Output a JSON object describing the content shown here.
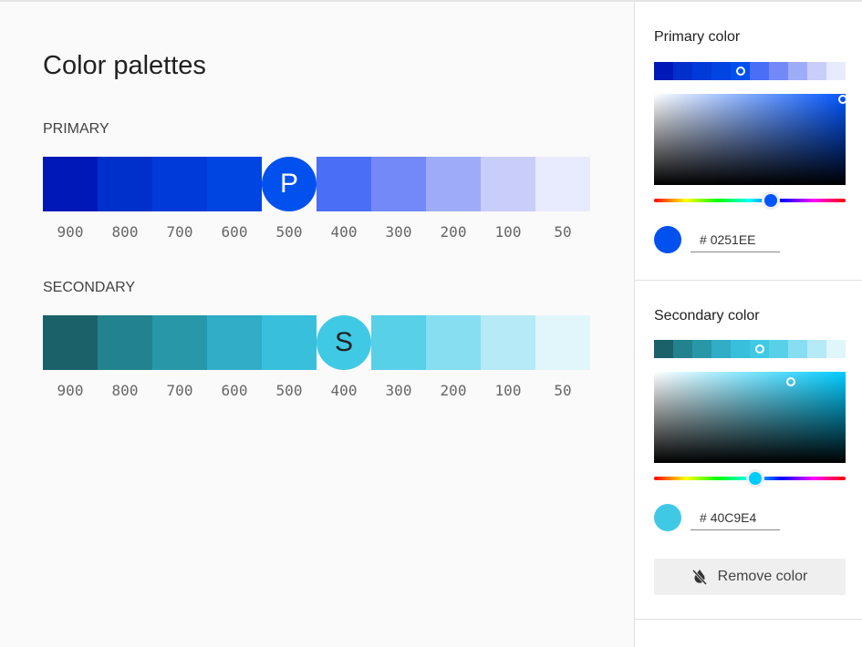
{
  "title": "Color palettes",
  "shades": [
    "900",
    "800",
    "700",
    "600",
    "500",
    "400",
    "300",
    "200",
    "100",
    "50"
  ],
  "primary": {
    "label": "PRIMARY",
    "letter": "P",
    "selected_index": 4,
    "colors": [
      "#0018b8",
      "#0030cc",
      "#003ad8",
      "#0045e2",
      "#0251ee",
      "#4a6ef5",
      "#7389f7",
      "#9eabf7",
      "#c8cdf9",
      "#e8eafd"
    ]
  },
  "secondary": {
    "label": "SECONDARY",
    "letter": "S",
    "selected_index": 5,
    "colors": [
      "#1a6169",
      "#22838f",
      "#2898a8",
      "#32adc8",
      "#38bfdc",
      "#40c9e4",
      "#58d0e8",
      "#86def0",
      "#b5eaf6",
      "#e0f6fb"
    ]
  },
  "side": {
    "primary": {
      "title": "Primary color",
      "hex": "0251EE",
      "color": "#0251EE",
      "hue_fraction": 0.61,
      "hue_color": "#0055ff"
    },
    "secondary": {
      "title": "Secondary color",
      "hex": "40C9E4",
      "color": "#40C9E4",
      "hue_fraction": 0.53,
      "hue_color": "#00ccff"
    },
    "remove_label": "Remove color",
    "hash": "#"
  }
}
